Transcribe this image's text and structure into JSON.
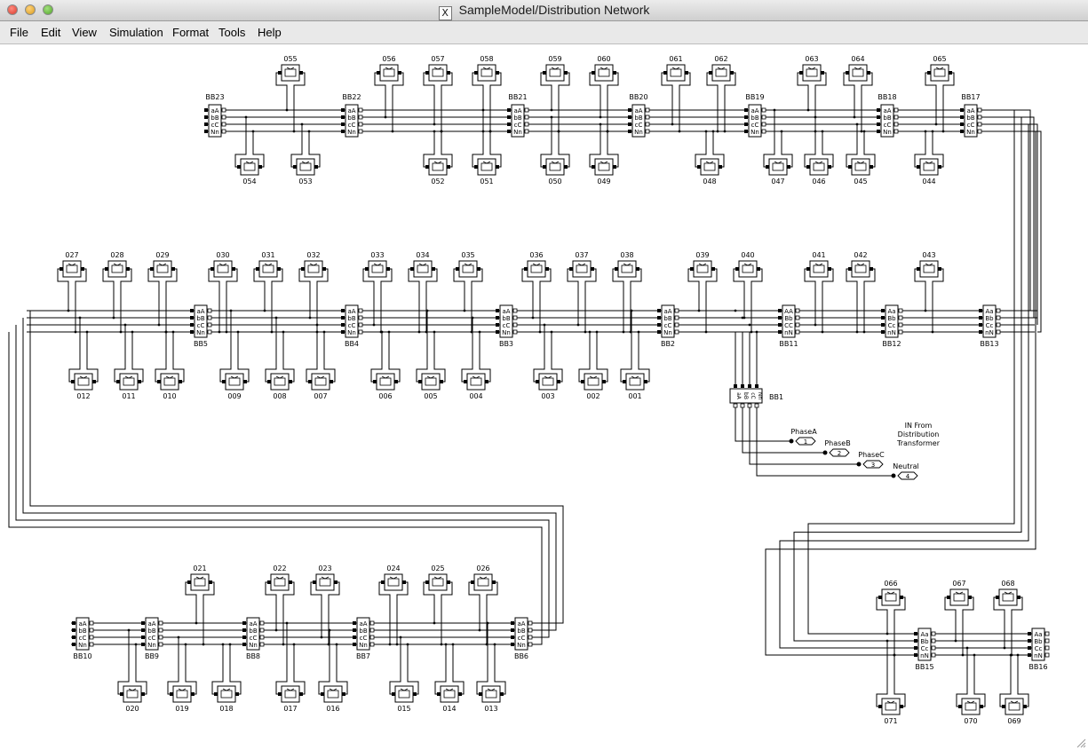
{
  "window": {
    "title": "SampleModel/Distribution Network",
    "title_icon": "x11-icon"
  },
  "menu": [
    "File",
    "Edit",
    "View",
    "Simulation",
    "Format",
    "Tools",
    "Help"
  ],
  "source": {
    "label_lines": [
      "IN From",
      "Distribution",
      "Transformer"
    ],
    "bus": "BB1",
    "phases": [
      {
        "name": "PhaseA",
        "port": "1"
      },
      {
        "name": "PhaseB",
        "port": "2"
      },
      {
        "name": "PhaseC",
        "port": "3"
      },
      {
        "name": "Neutral",
        "port": "4"
      }
    ]
  },
  "buses": {
    "BB1": {
      "pins": [
        "aA",
        "bB",
        "cC",
        "Nn"
      ]
    },
    "BB2": {
      "pins": [
        "aA",
        "bB",
        "cC",
        "Nn"
      ]
    },
    "BB3": {
      "pins": [
        "aA",
        "bB",
        "cC",
        "Nn"
      ]
    },
    "BB4": {
      "pins": [
        "aA",
        "bB",
        "cC",
        "Nn"
      ]
    },
    "BB5": {
      "pins": [
        "aA",
        "bB",
        "cC",
        "Nn"
      ]
    },
    "BB6": {
      "pins": [
        "aA",
        "bB",
        "cC",
        "Nn"
      ]
    },
    "BB7": {
      "pins": [
        "aA",
        "bB",
        "cC",
        "Nn"
      ]
    },
    "BB8": {
      "pins": [
        "aA",
        "bB",
        "cC",
        "Nn"
      ]
    },
    "BB9": {
      "pins": [
        "aA",
        "bB",
        "cC",
        "Nn"
      ]
    },
    "BB10": {
      "pins": [
        "aA",
        "bB",
        "cC",
        "Nn"
      ]
    },
    "BB11": {
      "pins": [
        "AA",
        "Bb",
        "CC",
        "nN"
      ]
    },
    "BB12": {
      "pins": [
        "Aa",
        "Bb",
        "Cc",
        "nN"
      ]
    },
    "BB13": {
      "pins": [
        "Aa",
        "Bb",
        "Cc",
        "nN"
      ]
    },
    "BB15": {
      "pins": [
        "Aa",
        "Bb",
        "Cc",
        "nN"
      ]
    },
    "BB16": {
      "pins": [
        "Aa",
        "Bb",
        "Cc",
        "nN"
      ]
    },
    "BB17": {
      "pins": [
        "aA",
        "bB",
        "cC",
        "Nn"
      ]
    },
    "BB18": {
      "pins": [
        "aA",
        "bB",
        "cC",
        "Nn"
      ]
    },
    "BB19": {
      "pins": [
        "aA",
        "bB",
        "cC",
        "Nn"
      ]
    },
    "BB20": {
      "pins": [
        "aA",
        "bB",
        "cC",
        "Nn"
      ]
    },
    "BB21": {
      "pins": [
        "aA",
        "bB",
        "cC",
        "Nn"
      ]
    },
    "BB22": {
      "pins": [
        "aA",
        "bB",
        "cC",
        "Nn"
      ]
    },
    "BB23": {
      "pins": [
        "aA",
        "bB",
        "cC",
        "Nn"
      ]
    }
  },
  "loads": {
    "row1_top": [
      "055",
      "056",
      "057",
      "058",
      "059",
      "060",
      "061",
      "062",
      "063",
      "064",
      "065"
    ],
    "row1_bottom": [
      "054",
      "053",
      "052",
      "051",
      "050",
      "049",
      "048",
      "047",
      "046",
      "045",
      "044"
    ],
    "row2_top": [
      "027",
      "028",
      "029",
      "030",
      "031",
      "032",
      "033",
      "034",
      "035",
      "036",
      "037",
      "038",
      "039",
      "040",
      "041",
      "042",
      "043"
    ],
    "row2_bottom": [
      "012",
      "011",
      "010",
      "009",
      "008",
      "007",
      "006",
      "005",
      "004",
      "003",
      "002",
      "001"
    ],
    "row3_top": [
      "021",
      "022",
      "023",
      "024",
      "025",
      "026"
    ],
    "row3_bottom": [
      "020",
      "019",
      "018",
      "017",
      "016",
      "015",
      "014",
      "013"
    ],
    "branch_top": [
      "066",
      "067",
      "068"
    ],
    "branch_bottom": [
      "071",
      "070",
      "069"
    ]
  }
}
